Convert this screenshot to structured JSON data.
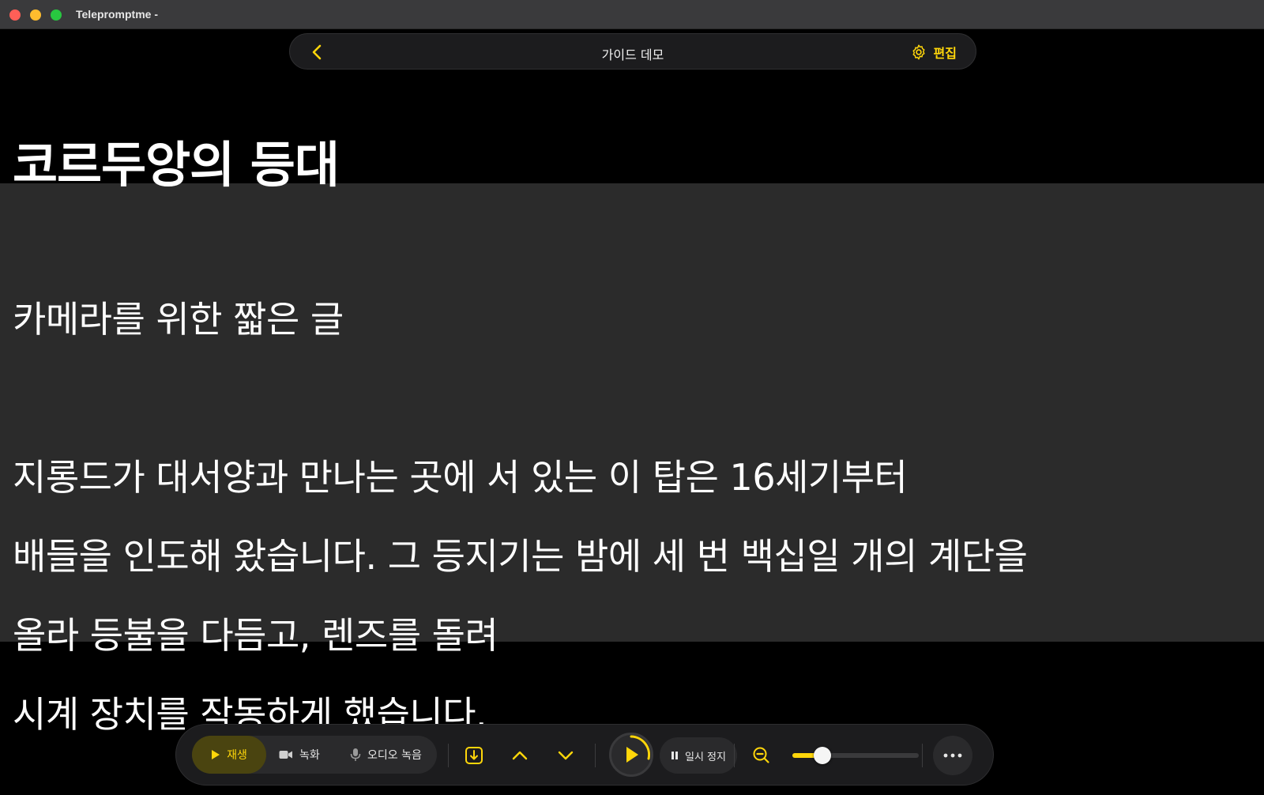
{
  "window": {
    "title": "Telepromptme -"
  },
  "nav": {
    "back_icon": "chevron-left-icon",
    "title": "가이드 데모",
    "edit_icon": "gear-icon",
    "edit_label": "편집"
  },
  "script": {
    "title": "코르두앙의 등대",
    "lines": [
      "카메라를 위한 짧은 글",
      "지롱드가 대서양과 만나는 곳에 서 있는 이 탑은 16세기부터",
      "배들을 인도해 왔습니다. 그 등지기는 밤에 세 번 백십일 개의 계단을",
      "올라 등불을 다듬고, 렌즈를 돌려",
      "시계 장치를 작동하게 했습니다."
    ]
  },
  "controls": {
    "modes": [
      {
        "label": "재생",
        "icon": "play-icon",
        "active": true
      },
      {
        "label": "녹화",
        "icon": "video-camera-icon",
        "active": false
      },
      {
        "label": "오디오 녹음",
        "icon": "microphone-icon",
        "active": false
      }
    ],
    "pause_label": "일시 정지",
    "speed_level": 0.24
  },
  "colors": {
    "accent": "#ffd60a",
    "background": "#000000",
    "reading_band": "#2b2b2b",
    "bar": "#1c1c1e"
  }
}
